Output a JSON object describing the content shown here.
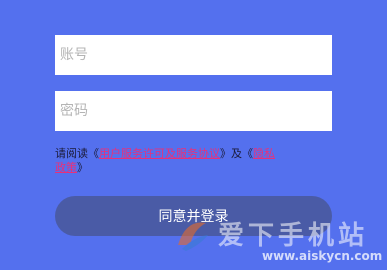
{
  "form": {
    "account_placeholder": "账号",
    "password_placeholder": "密码",
    "agreement": {
      "prefix": "请阅读《",
      "service_link": "用户服务许可及服务协议",
      "middle": "》及《",
      "privacy_link": "隐私政策",
      "suffix": "》"
    },
    "submit_label": "同意并登录"
  },
  "watermark": {
    "title": "爱下手机站",
    "url": "www.aiskycn.com"
  },
  "colors": {
    "background": "#5470ee",
    "button": "#4a5ba6",
    "link": "#e8307a"
  }
}
